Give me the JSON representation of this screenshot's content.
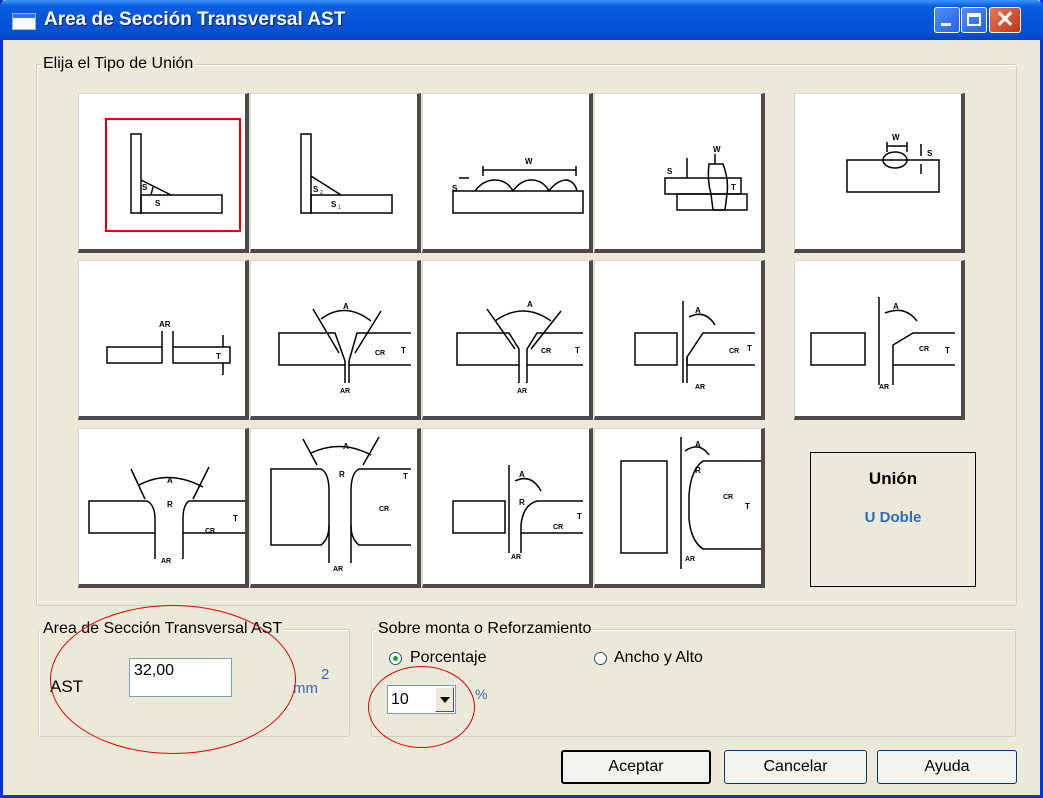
{
  "window": {
    "title": "Area de Sección Transversal AST"
  },
  "title_buttons": {
    "close_glyph": "✕"
  },
  "joint_group": {
    "legend": "Elija el Tipo de Unión",
    "diagram_labels": {
      "s": "S",
      "s1": "S",
      "s2": "S",
      "sub1": "1",
      "sub2": "2",
      "w": "W",
      "t": "T",
      "ar": "AR",
      "a": "A",
      "cr": "CR",
      "r": "R"
    }
  },
  "union_box": {
    "label": "Unión",
    "value": "U Doble"
  },
  "ast_group": {
    "legend": "Area de Sección Transversal AST",
    "label": "AST",
    "value": "32,00",
    "unit": "mm",
    "unit_sup": "2"
  },
  "reinforcement_group": {
    "legend": "Sobre monta o Reforzamiento",
    "option_percent": "Porcentaje",
    "option_width_height": "Ancho y Alto",
    "selected": "Porcentaje",
    "percent_value": "10",
    "percent_unit": "%"
  },
  "buttons": {
    "accept": "Aceptar",
    "cancel": "Cancelar",
    "help": "Ayuda"
  },
  "colors": {
    "title_bar": "#0555d8",
    "selection": "#e00000",
    "accent_text": "#2f6bbd"
  }
}
